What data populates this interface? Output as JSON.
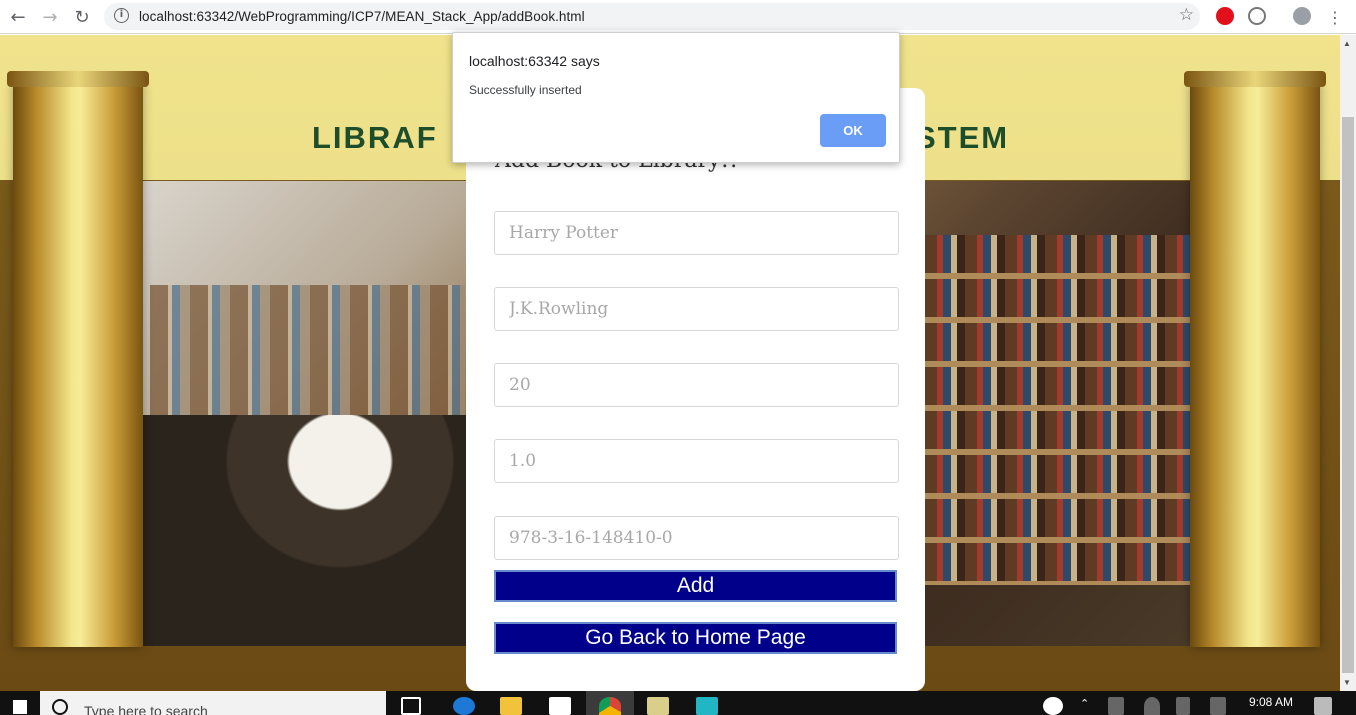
{
  "browser": {
    "url": "localhost:63342/WebProgramming/ICP7/MEAN_Stack_App/addBook.html",
    "back_icon": "back-arrow-icon",
    "forward_icon": "forward-arrow-icon",
    "reload_icon": "reload-icon"
  },
  "banner": {
    "left_text": "LIBRAF",
    "right_text": "STEM"
  },
  "form": {
    "title": "Add Book to Library!!",
    "title_placeholder": "Harry Potter",
    "author_placeholder": "J.K.Rowling",
    "count_placeholder": "20",
    "version_placeholder": "1.0",
    "isbn_placeholder": "978-3-16-148410-0",
    "add_label": "Add",
    "back_label": "Go Back to Home Page"
  },
  "dialog": {
    "origin": "localhost:63342 says",
    "message": "Successfully inserted",
    "ok_label": "OK"
  },
  "taskbar": {
    "search_placeholder": "Type here to search",
    "time": "9:08 AM"
  },
  "colors": {
    "button_bg": "#00008b",
    "ok_button": "#6a9df5",
    "banner_text": "#1e4d2b"
  }
}
